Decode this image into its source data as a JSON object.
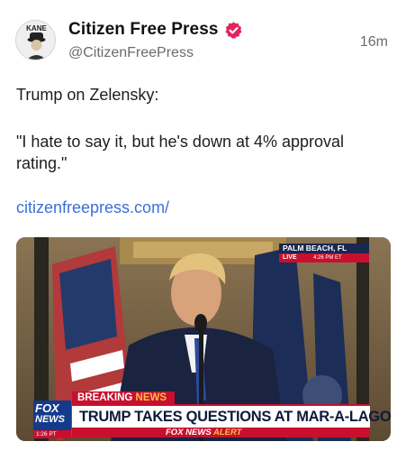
{
  "post": {
    "display_name": "Citizen Free Press",
    "handle": "@CitizenFreePress",
    "time": "16m",
    "avatar_label": "KANE",
    "text_line_1": "Trump on Zelensky:",
    "text_line_2": "\"I hate to say it, but he's down at 4% approval rating.\"",
    "link": "citizenfreepress.com/"
  },
  "media": {
    "location": "PALM BEACH, FL",
    "live": "LIVE",
    "live_time": "4:26 PM ET",
    "breaking_prefix": "BREAKING ",
    "breaking_word": "NEWS",
    "headline": "TRUMP TAKES QUESTIONS AT MAR-A-LAGO",
    "alert_prefix": "FOX NEWS ",
    "alert_word": "ALERT",
    "logo_fox": "FOX",
    "logo_news": "NEWS",
    "logo_time": "1:26 PT"
  },
  "colors": {
    "accent_link": "#3b6fd8",
    "verified": "#e0245e",
    "fox_red": "#c8102e",
    "fox_blue": "#143a8c"
  },
  "icons": [
    "verified-badge-icon"
  ]
}
